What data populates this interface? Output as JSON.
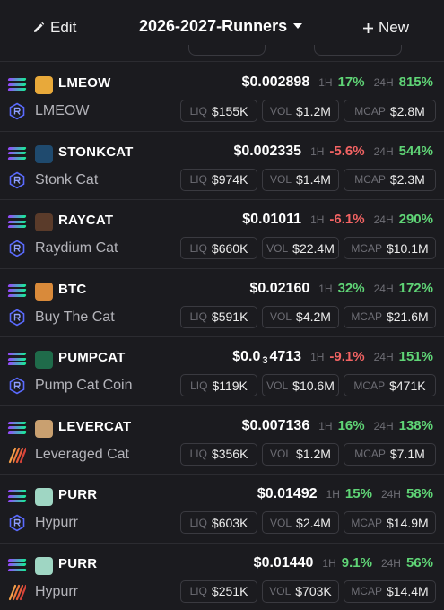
{
  "header": {
    "edit_label": "Edit",
    "list_title": "2026-2027-Runners",
    "new_label": "New"
  },
  "labels": {
    "h1": "1H",
    "h24": "24H",
    "liq": "LIQ",
    "vol": "VOL",
    "mcap": "MCAP"
  },
  "tokens": [
    {
      "symbol": "LMEOW",
      "name": "LMEOW",
      "price": "$0.002898",
      "price_parts": null,
      "chg_1h": "17%",
      "chg_1h_dir": "up",
      "chg_24h": "815%",
      "chg_24h_dir": "up",
      "liq": "$155K",
      "vol": "$1.2M",
      "mcap": "$2.8M",
      "dex": "raydium",
      "avatar_color": "#e8a93a"
    },
    {
      "symbol": "STONKCAT",
      "name": "Stonk Cat",
      "price": "$0.002335",
      "price_parts": null,
      "chg_1h": "-5.6%",
      "chg_1h_dir": "down",
      "chg_24h": "544%",
      "chg_24h_dir": "up",
      "liq": "$974K",
      "vol": "$1.4M",
      "mcap": "$2.3M",
      "dex": "raydium",
      "avatar_color": "#1f4a6e"
    },
    {
      "symbol": "RAYCAT",
      "name": "Raydium Cat",
      "price": "$0.01011",
      "price_parts": null,
      "chg_1h": "-6.1%",
      "chg_1h_dir": "down",
      "chg_24h": "290%",
      "chg_24h_dir": "up",
      "liq": "$660K",
      "vol": "$22.4M",
      "mcap": "$10.1M",
      "dex": "raydium",
      "avatar_color": "#5a3b2a"
    },
    {
      "symbol": "BTC",
      "name": "Buy The Cat",
      "price": "$0.02160",
      "price_parts": null,
      "chg_1h": "32%",
      "chg_1h_dir": "up",
      "chg_24h": "172%",
      "chg_24h_dir": "up",
      "liq": "$591K",
      "vol": "$4.2M",
      "mcap": "$21.6M",
      "dex": "raydium",
      "avatar_color": "#d98a3a"
    },
    {
      "symbol": "PUMPCAT",
      "name": "Pump Cat Coin",
      "price": "$0.034713",
      "price_parts": {
        "lead": "$0.0",
        "zeros": "3",
        "tail": "4713"
      },
      "chg_1h": "-9.1%",
      "chg_1h_dir": "down",
      "chg_24h": "151%",
      "chg_24h_dir": "up",
      "liq": "$119K",
      "vol": "$10.6M",
      "mcap": "$471K",
      "dex": "raydium",
      "avatar_color": "#1f6b4a"
    },
    {
      "symbol": "LEVERCAT",
      "name": "Leveraged Cat",
      "price": "$0.007136",
      "price_parts": null,
      "chg_1h": "16%",
      "chg_1h_dir": "up",
      "chg_24h": "138%",
      "chg_24h_dir": "up",
      "liq": "$356K",
      "vol": "$1.2M",
      "mcap": "$7.1M",
      "dex": "meteora",
      "avatar_color": "#c9a070"
    },
    {
      "symbol": "PURR",
      "name": "Hypurr",
      "price": "$0.01492",
      "price_parts": null,
      "chg_1h": "15%",
      "chg_1h_dir": "up",
      "chg_24h": "58%",
      "chg_24h_dir": "up",
      "liq": "$603K",
      "vol": "$2.4M",
      "mcap": "$14.9M",
      "dex": "raydium",
      "avatar_color": "#9fd6c3"
    },
    {
      "symbol": "PURR",
      "name": "Hypurr",
      "price": "$0.01440",
      "price_parts": null,
      "chg_1h": "9.1%",
      "chg_1h_dir": "up",
      "chg_24h": "56%",
      "chg_24h_dir": "up",
      "liq": "$251K",
      "vol": "$703K",
      "mcap": "$14.4M",
      "dex": "meteora",
      "avatar_color": "#9fd6c3"
    }
  ],
  "colors": {
    "up": "#5fd476",
    "down": "#f26363",
    "background": "#1b1b1f"
  }
}
